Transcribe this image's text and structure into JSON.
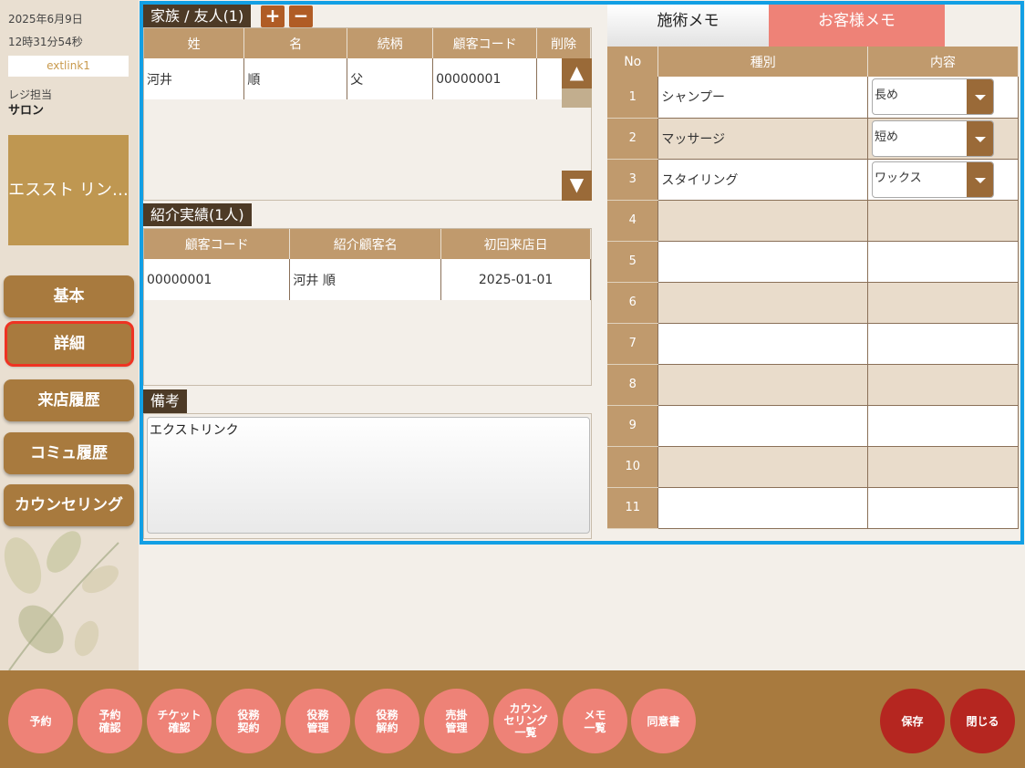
{
  "sidebar": {
    "date": "2025年6月9日",
    "time": "12時31分54秒",
    "user_id": "extlink1",
    "role_label": "レジ担当",
    "store_name": "サロン",
    "customer_name": "エススト リン…",
    "nav": [
      {
        "label": "基本",
        "active": false
      },
      {
        "label": "詳細",
        "active": true
      },
      {
        "label": "来店履歴",
        "active": false
      },
      {
        "label": "コミュ履歴",
        "active": false
      },
      {
        "label": "カウンセリング",
        "active": false
      }
    ]
  },
  "family": {
    "title": "家族 / 友人(1)",
    "add_label": "+",
    "remove_label": "−",
    "headers": [
      "姓",
      "名",
      "続柄",
      "顧客コード",
      "削除"
    ],
    "rows": [
      {
        "last": "河井",
        "first": "順",
        "relation": "父",
        "code": "00000001"
      }
    ],
    "scroll_up": "▲",
    "scroll_down": "▼"
  },
  "referral": {
    "title": "紹介実績(1人)",
    "headers": [
      "顧客コード",
      "紹介顧客名",
      "初回来店日"
    ],
    "rows": [
      {
        "code": "00000001",
        "name": "河井 順",
        "first_visit": "2025-01-01"
      }
    ]
  },
  "notes": {
    "title": "備考",
    "value": "エクストリンク"
  },
  "memo": {
    "tabs": [
      {
        "label": "施術メモ",
        "active": true
      },
      {
        "label": "お客様メモ",
        "active": false
      }
    ],
    "headers": {
      "no": "No",
      "type": "種別",
      "content": "内容"
    },
    "rows": [
      {
        "no": "1",
        "type": "シャンプー",
        "content": "長め"
      },
      {
        "no": "2",
        "type": "マッサージ",
        "content": "短め"
      },
      {
        "no": "3",
        "type": "スタイリング",
        "content": "ワックス"
      },
      {
        "no": "4",
        "type": "",
        "content": ""
      },
      {
        "no": "5",
        "type": "",
        "content": ""
      },
      {
        "no": "6",
        "type": "",
        "content": ""
      },
      {
        "no": "7",
        "type": "",
        "content": ""
      },
      {
        "no": "8",
        "type": "",
        "content": ""
      },
      {
        "no": "9",
        "type": "",
        "content": ""
      },
      {
        "no": "10",
        "type": "",
        "content": ""
      },
      {
        "no": "11",
        "type": "",
        "content": ""
      }
    ]
  },
  "footer": {
    "buttons": [
      {
        "label": "予約"
      },
      {
        "label": "予約\n確認"
      },
      {
        "label": "チケット\n確認"
      },
      {
        "label": "役務\n契約"
      },
      {
        "label": "役務\n管理"
      },
      {
        "label": "役務\n解約"
      },
      {
        "label": "売掛\n管理"
      },
      {
        "label": "カウン\nセリング\n一覧"
      },
      {
        "label": "メモ\n一覧"
      },
      {
        "label": "同意書"
      }
    ],
    "save_label": "保存",
    "close_label": "閉じる"
  },
  "colors": {
    "accent_border": "#129fe4",
    "brown": "#a87a3e",
    "header_tan": "#c09a6d",
    "salmon": "#ee8277",
    "dark_red": "#b52620"
  }
}
